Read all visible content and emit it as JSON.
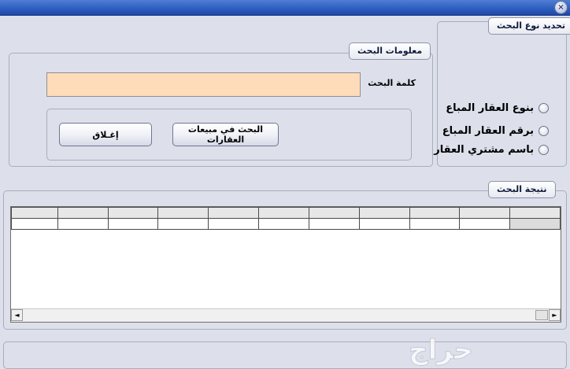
{
  "window": {
    "close_glyph": "×"
  },
  "search_type": {
    "legend": "تحديد نوع البحث",
    "options": [
      "بنوع العقار المباع",
      "برقم العقار المباع",
      "باسم مشتري العقار"
    ]
  },
  "search_info": {
    "legend": "معلومات البحث",
    "keyword_label": "كلمة البحث",
    "keyword_value": "",
    "search_button": "البحث في مبيعات العقارات",
    "close_button": "إغـلاق"
  },
  "results": {
    "legend": "نتيجة البحث",
    "scroll_left": "◄",
    "scroll_right": "►"
  },
  "watermark": {
    "text": "حراج"
  }
}
